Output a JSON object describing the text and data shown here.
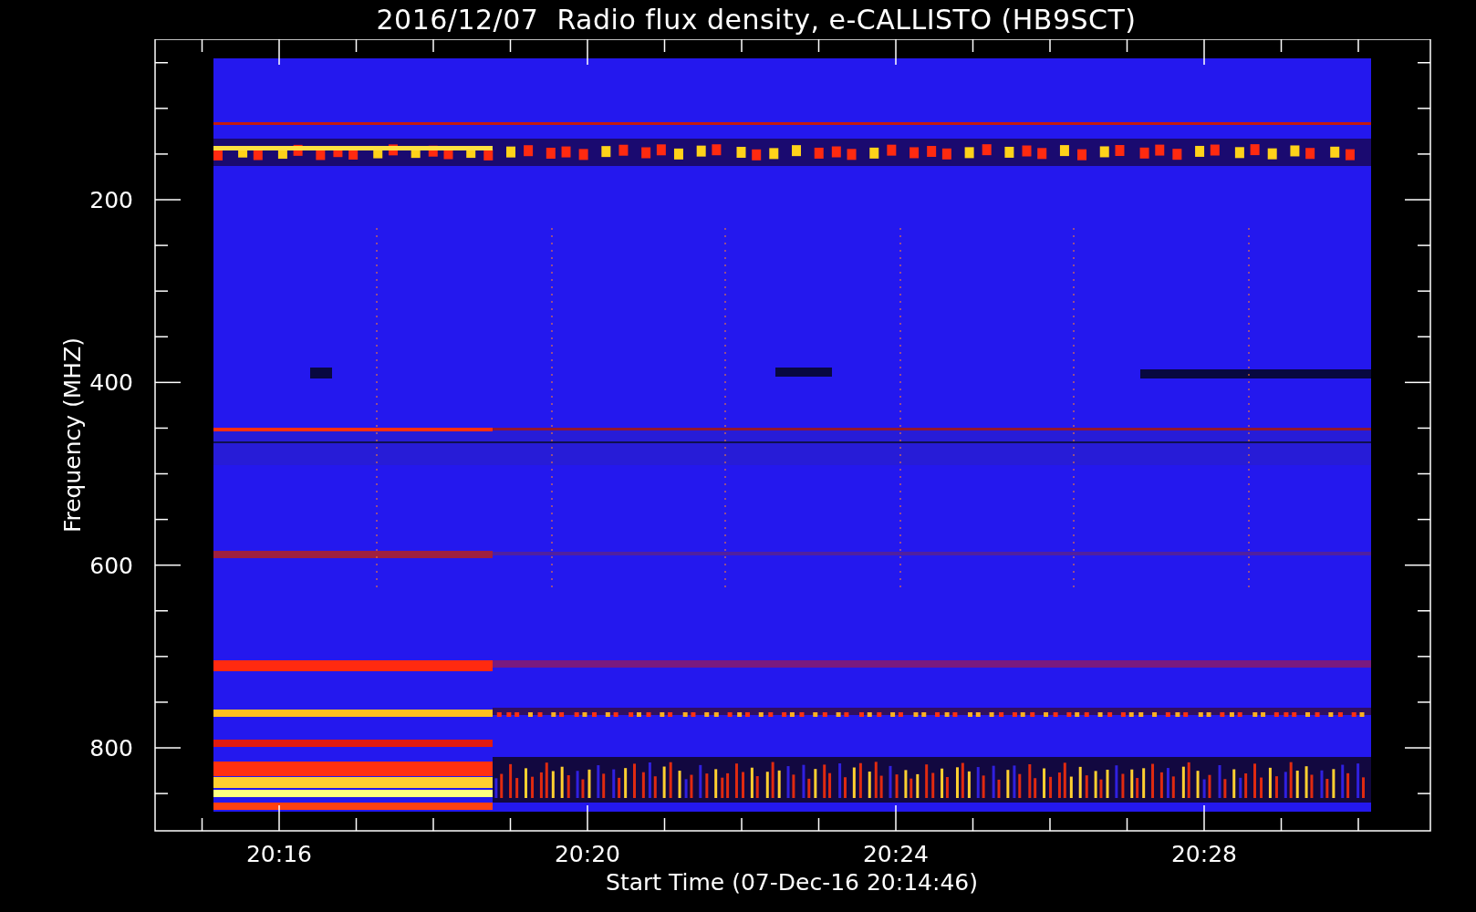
{
  "title": "2016/12/07  Radio flux density, e-CALLISTO (HB9SCT)",
  "ylabel": "Frequency (MHZ)",
  "xlabel": "Start Time (07-Dec-16 20:14:46)",
  "yticks": [
    "200",
    "400",
    "600",
    "800"
  ],
  "xticks": [
    "20:16",
    "20:20",
    "20:24",
    "20:28"
  ]
}
